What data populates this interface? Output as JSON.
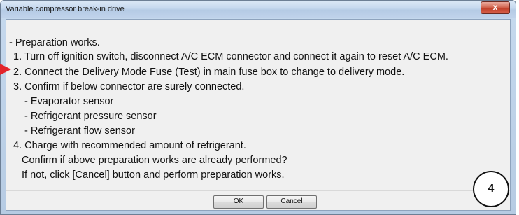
{
  "window": {
    "title": "Variable compressor break-in drive",
    "close_label": "x"
  },
  "message": {
    "lines": [
      "- Preparation works.",
      "1. Turn off ignition switch, disconnect A/C ECM connector and connect it again to reset A/C ECM.",
      "2. Connect the Delivery Mode Fuse (Test) in main fuse box to change to delivery mode.",
      "3. Confirm if below connector are surely connected.",
      "- Evaporator sensor",
      "- Refrigerant pressure sensor",
      "- Refrigerant flow sensor",
      "4. Charge with recommended amount of refrigerant.",
      "Confirm if above preparation works are already performed?",
      "If not, click [Cancel] button and perform preparation works."
    ]
  },
  "buttons": {
    "ok_label": "OK",
    "cancel_label": "Cancel"
  },
  "annotation": {
    "step_number": "4",
    "arrow_color": "#e3242b"
  }
}
